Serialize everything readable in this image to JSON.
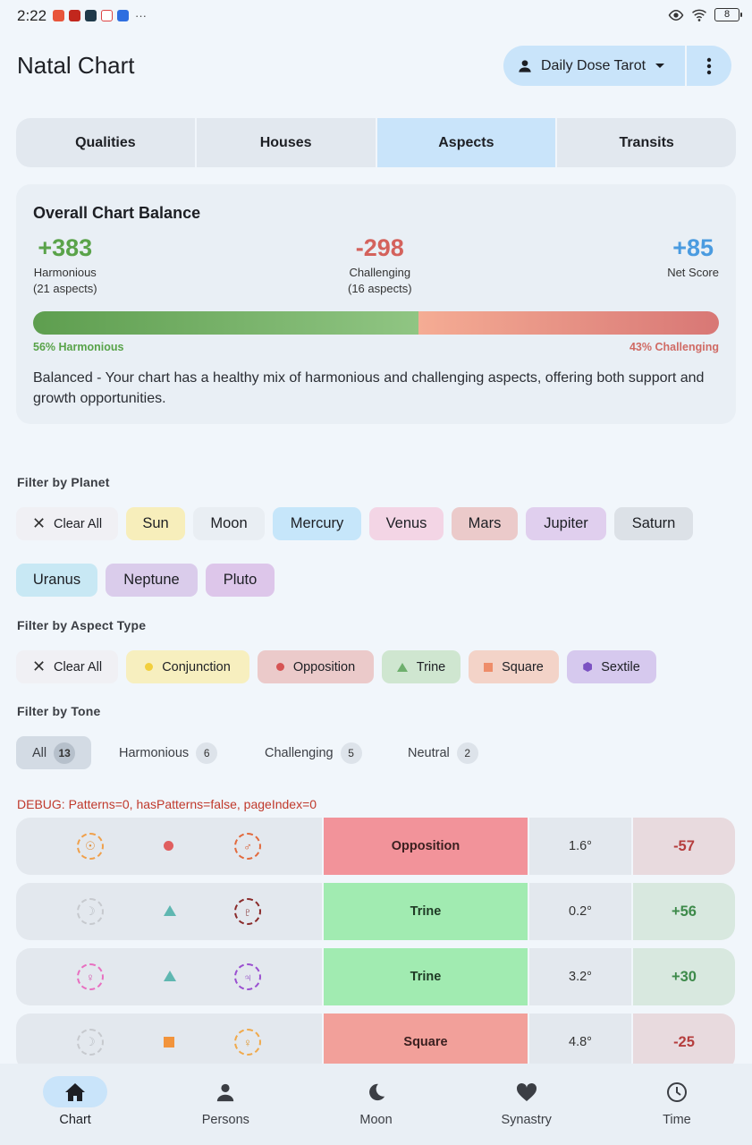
{
  "status_bar": {
    "time": "2:22",
    "battery": "8",
    "more": "···"
  },
  "header": {
    "title": "Natal Chart",
    "profile_label": "Daily Dose Tarot"
  },
  "tabs": [
    {
      "label": "Qualities"
    },
    {
      "label": "Houses"
    },
    {
      "label": "Aspects"
    },
    {
      "label": "Transits"
    }
  ],
  "balance": {
    "title": "Overall Chart Balance",
    "harmonious": {
      "value": "+383",
      "label": "Harmonious",
      "sub": "(21 aspects)"
    },
    "challenging": {
      "value": "-298",
      "label": "Challenging",
      "sub": "(16 aspects)"
    },
    "net": {
      "value": "+85",
      "label": "Net Score"
    },
    "harmonious_fraction": 0.562,
    "harmonious_pct_label": "56% Harmonious",
    "challenging_pct_label": "43% Challenging",
    "description": "Balanced - Your chart has a healthy mix of harmonious and challenging aspects, offering both support and growth opportunities."
  },
  "filters": {
    "planet_label": "Filter by Planet",
    "clear_all": "Clear All",
    "planets": [
      "Sun",
      "Moon",
      "Mercury",
      "Venus",
      "Mars",
      "Jupiter",
      "Saturn",
      "Uranus",
      "Neptune",
      "Pluto"
    ],
    "aspect_label": "Filter by Aspect Type",
    "aspects": [
      "Conjunction",
      "Opposition",
      "Trine",
      "Square",
      "Sextile"
    ],
    "tone_label": "Filter by Tone",
    "tones": [
      {
        "label": "All",
        "count": "13"
      },
      {
        "label": "Harmonious",
        "count": "6"
      },
      {
        "label": "Challenging",
        "count": "5"
      },
      {
        "label": "Neutral",
        "count": "2"
      }
    ]
  },
  "debug_text": "DEBUG: Patterns=0, hasPatterns=false, pageIndex=0",
  "aspect_rows": [
    {
      "p1_glyph": "☉",
      "p2_glyph": "♂",
      "type": "Opposition",
      "orb": "1.6°",
      "score": "-57"
    },
    {
      "p1_glyph": "☽",
      "p2_glyph": "♇",
      "type": "Trine",
      "orb": "0.2°",
      "score": "+56"
    },
    {
      "p1_glyph": "♀",
      "p2_glyph": "♃",
      "type": "Trine",
      "orb": "3.2°",
      "score": "+30"
    },
    {
      "p1_glyph": "☽",
      "p2_glyph": "♀",
      "type": "Square",
      "orb": "4.8°",
      "score": "-25"
    }
  ],
  "nav": [
    {
      "label": "Chart"
    },
    {
      "label": "Persons"
    },
    {
      "label": "Moon"
    },
    {
      "label": "Synastry"
    },
    {
      "label": "Time"
    }
  ],
  "colors": {
    "accent": "#c9e4fa",
    "harmonious": "#5aa34a",
    "challenging": "#d4625c",
    "net": "#4a9be0",
    "debug": "#c0392b"
  }
}
